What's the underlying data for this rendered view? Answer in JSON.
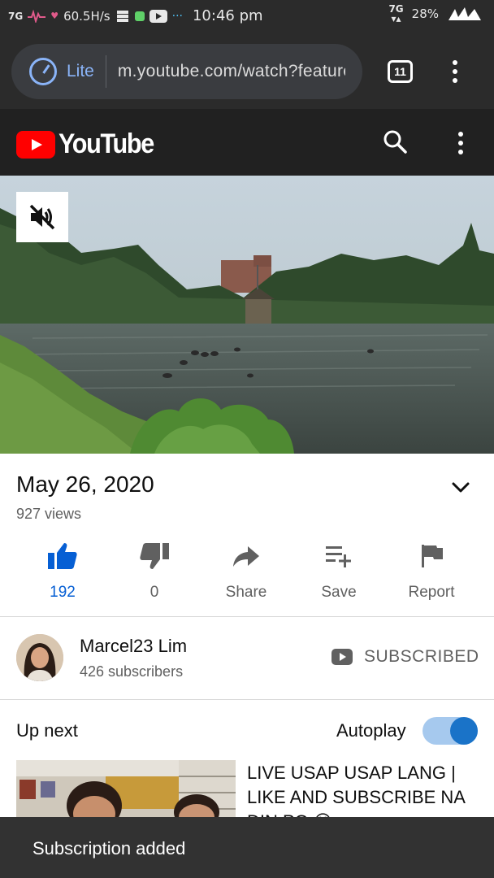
{
  "status_bar": {
    "network_left": "7G",
    "speed": "60.5H/s",
    "time": "10:46 pm",
    "network_right": "7G",
    "battery": "28%"
  },
  "browser": {
    "mode_label": "Lite",
    "url": "m.youtube.com/watch?feature=share",
    "tab_count": "11"
  },
  "youtube": {
    "wordmark": "YouTube"
  },
  "video": {
    "date": "May 26, 2020",
    "views": "927 views",
    "muted": true
  },
  "actions": [
    {
      "id": "like",
      "icon": "thumbs-up-icon",
      "label": "192",
      "active": true
    },
    {
      "id": "dislike",
      "icon": "thumbs-down-icon",
      "label": "0"
    },
    {
      "id": "share",
      "icon": "share-icon",
      "label": "Share"
    },
    {
      "id": "save",
      "icon": "playlist-add-icon",
      "label": "Save"
    },
    {
      "id": "report",
      "icon": "flag-icon",
      "label": "Report"
    }
  ],
  "channel": {
    "name": "Marcel23 Lim",
    "subscribers": "426 subscribers",
    "subscribe_state": "SUBSCRIBED"
  },
  "up_next": {
    "heading": "Up next",
    "autoplay_label": "Autoplay",
    "autoplay_on": true,
    "item": {
      "title": "LIVE USAP USAP LANG | LIKE AND SUBSCRIBE NA DIN PO 😊"
    }
  },
  "snackbar": {
    "message": "Subscription added"
  },
  "colors": {
    "youtube_red": "#ff0000",
    "liked_blue": "#065fd4",
    "toggle_track": "#a6c9ee",
    "toggle_knob": "#1a73c8",
    "lite_blue": "#8ab4f8"
  }
}
